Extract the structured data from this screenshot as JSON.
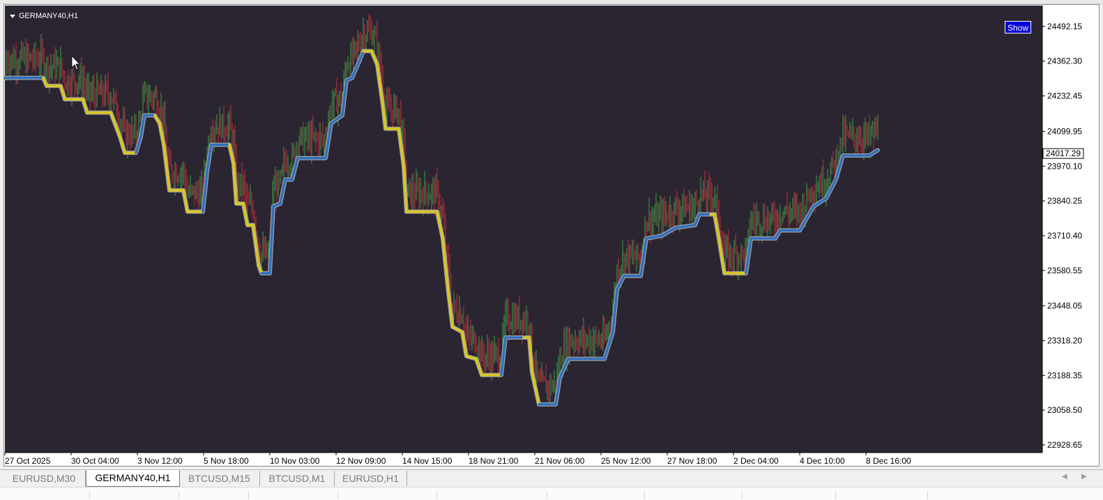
{
  "window": {
    "symbol_title": "GERMANY40,H1",
    "show_button": "Show"
  },
  "theme": {
    "chart_bg": "#2a2531",
    "axis_bg": "#ffffff",
    "bull_color": "#3fa046",
    "bear_color": "#c8303c",
    "line_up": "#2f6fc0",
    "line_down": "#d9c81c",
    "line_outline": "#a0a0a0"
  },
  "tabs": [
    {
      "label": "EURUSD,M30",
      "active": false
    },
    {
      "label": "GERMANY40,H1",
      "active": true
    },
    {
      "label": "BTCUSD,M15",
      "active": false
    },
    {
      "label": "BTCUSD,M1",
      "active": false
    },
    {
      "label": "EURUSD,H1",
      "active": false
    }
  ],
  "chart_data": {
    "type": "line",
    "symbol": "GERMANY40",
    "timeframe": "H1",
    "current_price": "24017.29",
    "y_ticks": [
      "24492.15",
      "24362.30",
      "24232.45",
      "24099.95",
      "23970.10",
      "23840.25",
      "23710.40",
      "23580.55",
      "23448.05",
      "23318.20",
      "23188.35",
      "23058.50",
      "22928.65"
    ],
    "ylim": [
      22900,
      24570
    ],
    "x_ticks": [
      "27 Oct 2025",
      "30 Oct 04:00",
      "3 Nov 12:00",
      "5 Nov 18:00",
      "10 Nov 03:00",
      "12 Nov 09:00",
      "14 Nov 15:00",
      "18 Nov 21:00",
      "21 Nov 06:00",
      "25 Nov 12:00",
      "27 Nov 18:00",
      "2 Dec 04:00",
      "4 Dec 10:00",
      "8 Dec 16:00"
    ],
    "trend_line": [
      [
        0,
        24300,
        "up"
      ],
      [
        55,
        24300,
        "up"
      ],
      [
        60,
        24270,
        "down"
      ],
      [
        80,
        24270,
        "down"
      ],
      [
        86,
        24220,
        "down"
      ],
      [
        112,
        24220,
        "down"
      ],
      [
        118,
        24170,
        "down"
      ],
      [
        152,
        24170,
        "down"
      ],
      [
        165,
        24080,
        "down"
      ],
      [
        172,
        24020,
        "down"
      ],
      [
        188,
        24020,
        "down"
      ],
      [
        195,
        24080,
        "up"
      ],
      [
        200,
        24160,
        "up"
      ],
      [
        215,
        24160,
        "up"
      ],
      [
        222,
        24130,
        "down"
      ],
      [
        228,
        24050,
        "down"
      ],
      [
        236,
        23880,
        "down"
      ],
      [
        256,
        23880,
        "down"
      ],
      [
        262,
        23800,
        "down"
      ],
      [
        284,
        23800,
        "down"
      ],
      [
        290,
        23950,
        "up"
      ],
      [
        296,
        24050,
        "up"
      ],
      [
        322,
        24050,
        "up"
      ],
      [
        328,
        23980,
        "down"
      ],
      [
        332,
        23830,
        "down"
      ],
      [
        342,
        23830,
        "down"
      ],
      [
        348,
        23750,
        "down"
      ],
      [
        356,
        23750,
        "down"
      ],
      [
        364,
        23600,
        "down"
      ],
      [
        368,
        23570,
        "down"
      ],
      [
        380,
        23570,
        "up"
      ],
      [
        385,
        23820,
        "up"
      ],
      [
        395,
        23830,
        "up"
      ],
      [
        402,
        23920,
        "up"
      ],
      [
        412,
        23920,
        "up"
      ],
      [
        420,
        24000,
        "up"
      ],
      [
        460,
        24000,
        "up"
      ],
      [
        468,
        24130,
        "up"
      ],
      [
        484,
        24160,
        "up"
      ],
      [
        490,
        24290,
        "up"
      ],
      [
        498,
        24300,
        "up"
      ],
      [
        508,
        24360,
        "up"
      ],
      [
        514,
        24400,
        "up"
      ],
      [
        526,
        24400,
        "down"
      ],
      [
        534,
        24350,
        "down"
      ],
      [
        542,
        24200,
        "down"
      ],
      [
        546,
        24110,
        "down"
      ],
      [
        565,
        24110,
        "down"
      ],
      [
        572,
        23970,
        "down"
      ],
      [
        576,
        23800,
        "down"
      ],
      [
        620,
        23800,
        "down"
      ],
      [
        628,
        23700,
        "down"
      ],
      [
        636,
        23500,
        "down"
      ],
      [
        642,
        23370,
        "down"
      ],
      [
        656,
        23350,
        "down"
      ],
      [
        662,
        23260,
        "down"
      ],
      [
        676,
        23250,
        "down"
      ],
      [
        684,
        23190,
        "down"
      ],
      [
        712,
        23190,
        "down"
      ],
      [
        718,
        23330,
        "up"
      ],
      [
        744,
        23330,
        "up"
      ],
      [
        752,
        23330,
        "down"
      ],
      [
        756,
        23200,
        "down"
      ],
      [
        766,
        23080,
        "down"
      ],
      [
        790,
        23080,
        "up"
      ],
      [
        796,
        23180,
        "up"
      ],
      [
        808,
        23250,
        "up"
      ],
      [
        860,
        23250,
        "up"
      ],
      [
        872,
        23350,
        "up"
      ],
      [
        878,
        23510,
        "up"
      ],
      [
        888,
        23560,
        "up"
      ],
      [
        912,
        23560,
        "up"
      ],
      [
        920,
        23700,
        "up"
      ],
      [
        942,
        23710,
        "up"
      ],
      [
        962,
        23740,
        "up"
      ],
      [
        990,
        23750,
        "up"
      ],
      [
        996,
        23790,
        "up"
      ],
      [
        1012,
        23790,
        "up"
      ],
      [
        1018,
        23790,
        "down"
      ],
      [
        1024,
        23700,
        "down"
      ],
      [
        1032,
        23570,
        "down"
      ],
      [
        1063,
        23570,
        "down"
      ],
      [
        1070,
        23700,
        "up"
      ],
      [
        1105,
        23700,
        "up"
      ],
      [
        1112,
        23730,
        "up"
      ],
      [
        1140,
        23730,
        "up"
      ],
      [
        1160,
        23820,
        "up"
      ],
      [
        1178,
        23850,
        "up"
      ],
      [
        1192,
        23920,
        "up"
      ],
      [
        1202,
        24010,
        "up"
      ],
      [
        1240,
        24010,
        "up"
      ],
      [
        1252,
        24030,
        "up"
      ]
    ]
  }
}
